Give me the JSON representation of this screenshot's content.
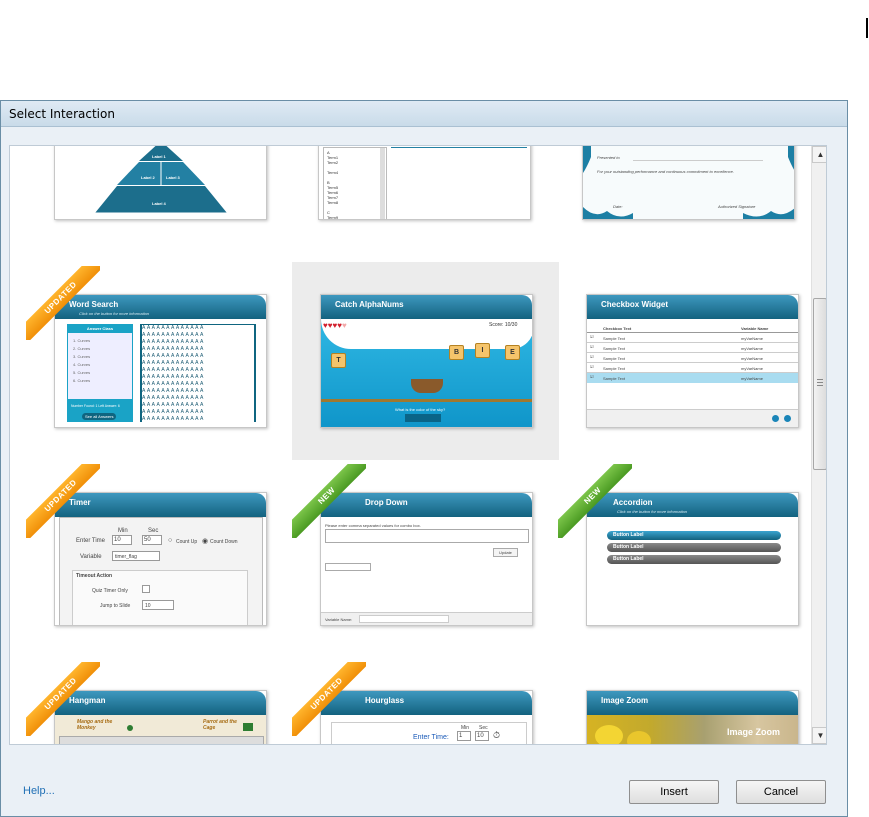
{
  "window": {
    "title": "Select Interaction"
  },
  "footer": {
    "help_link": "Help...",
    "insert_label": "Insert",
    "cancel_label": "Cancel"
  },
  "colors": {
    "header_blue": "#1f7aa0",
    "updated_orange": "#f7a01a",
    "new_green": "#5fae32"
  },
  "top_row": {
    "pyramid": {
      "label1": "Label 1",
      "label2": "Label 2",
      "label3": "Label 3",
      "label4": "Label 4"
    },
    "glossary": {
      "items": [
        "A",
        "Term1",
        "Term2",
        "",
        "Term4",
        "",
        "B",
        "Term5",
        "Term6",
        "Term7",
        "Term8",
        "",
        "C",
        "Term9"
      ]
    },
    "certificate": {
      "presented_to": "Presented to",
      "line": "For your outstanding performance and continuous commitment to excellence.",
      "date": "Date:",
      "signature": "Authorized Signature"
    }
  },
  "tiles": [
    {
      "title": "Word Search",
      "subtitle": "Click on the button for more information",
      "badge": "UPDATED",
      "answer_class": "Answer Class",
      "answers": [
        "1. Curves",
        "2. Curves",
        "3. Curves",
        "4. Curves",
        "5. Curves",
        "6. Curves"
      ],
      "footer": "Number Found: 1   Left Answer: 6",
      "see_all": "See all Answers"
    },
    {
      "title": "Catch AlphaNums",
      "badge": "",
      "score": "Score: 10/30",
      "letters": [
        "T",
        "B",
        "I",
        "E"
      ],
      "question": "What is the color of the sky?"
    },
    {
      "title": "Checkbox Widget",
      "badge": "",
      "col1": "Checkbox Text",
      "col2": "Variable Name",
      "rows": [
        {
          "text": "Sample Text",
          "var": "myVarName"
        },
        {
          "text": "Sample Text",
          "var": "myVarName"
        },
        {
          "text": "Sample Text",
          "var": "myVarName"
        },
        {
          "text": "Sample Text",
          "var": "myVarName"
        },
        {
          "text": "Sample Text",
          "var": "myVarName"
        }
      ]
    },
    {
      "title": "Timer",
      "badge": "UPDATED",
      "min_label": "Min",
      "sec_label": "Sec",
      "enter_time": "Enter Time",
      "min_val": "10",
      "sec_val": "50",
      "count_up": "Count Up",
      "count_down": "Count Down",
      "variable": "Variable",
      "variable_val": "timer_flag",
      "timeout_action": "Timeout Action",
      "quiz_timer_only": "Quiz Timer Only",
      "jump_to_slide": "Jump to Slide",
      "jump_val": "10"
    },
    {
      "title": "Drop Down",
      "badge": "NEW",
      "instructions": "Please enter comma separated values for combo box.",
      "update": "Update",
      "variable_name": "Variable Name:"
    },
    {
      "title": "Accordion",
      "subtitle": "Click on the button for more information",
      "badge": "NEW",
      "buttons": [
        "Button Label",
        "Button Label",
        "Button Label"
      ]
    },
    {
      "title": "Hangman",
      "badge": "UPDATED",
      "left_caption": "Mango and the Monkey",
      "right_caption": "Parrot and the Cage"
    },
    {
      "title": "Hourglass",
      "badge": "UPDATED",
      "min_label": "Min",
      "sec_label": "Sec",
      "enter_time": "Enter Time:",
      "min_val": "1",
      "sec_val": "10"
    },
    {
      "title": "Image Zoom",
      "badge": "",
      "overlay": "Image Zoom"
    }
  ]
}
